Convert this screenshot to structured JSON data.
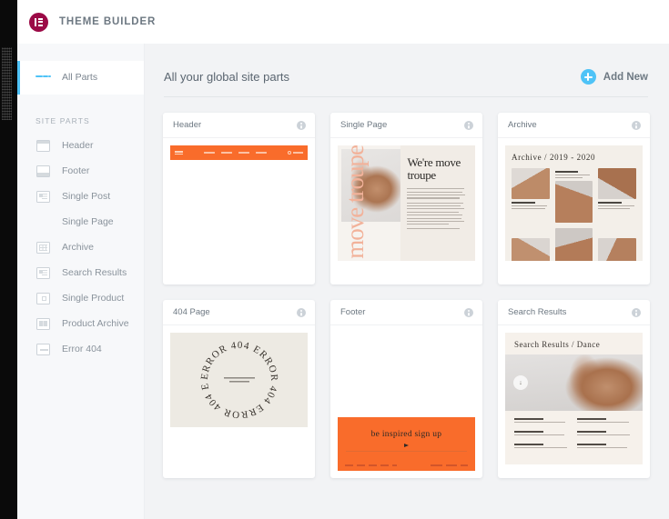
{
  "app": {
    "title": "THEME BUILDER",
    "logo_icon": "elementor-logo-icon",
    "brand_color": "#9b0a46",
    "accent_color": "#4fc3f7",
    "orange_color": "#f96c2b"
  },
  "sidebar": {
    "all_parts": {
      "label": "All Parts",
      "icon": "filter-lines-icon",
      "active": true
    },
    "section_label": "SITE PARTS",
    "items": [
      {
        "label": "Header",
        "icon": "header-layout-icon"
      },
      {
        "label": "Footer",
        "icon": "footer-layout-icon"
      },
      {
        "label": "Single Post",
        "icon": "single-post-icon"
      },
      {
        "label": "Single Page",
        "icon": "none"
      },
      {
        "label": "Archive",
        "icon": "archive-grid-icon"
      },
      {
        "label": "Search Results",
        "icon": "search-results-icon"
      },
      {
        "label": "Single Product",
        "icon": "single-product-icon"
      },
      {
        "label": "Product Archive",
        "icon": "product-archive-icon"
      },
      {
        "label": "Error 404",
        "icon": "error-404-icon"
      }
    ]
  },
  "main": {
    "title": "All your global site parts",
    "add_new": {
      "label": "Add New",
      "icon": "plus-circle-icon"
    },
    "cards": [
      {
        "name": "Header",
        "info_icon": "info-icon",
        "preview": "header"
      },
      {
        "name": "Single Page",
        "info_icon": "info-icon",
        "preview": "single-page"
      },
      {
        "name": "Archive",
        "info_icon": "info-icon",
        "preview": "archive"
      },
      {
        "name": "404 Page",
        "info_icon": "info-icon",
        "preview": "error-404"
      },
      {
        "name": "Footer",
        "info_icon": "info-icon",
        "preview": "footer"
      },
      {
        "name": "Search Results",
        "info_icon": "info-icon",
        "preview": "search-results"
      }
    ]
  },
  "previews": {
    "single_page": {
      "heading": "We're move troupe",
      "vertical_text": "move troupe"
    },
    "archive": {
      "title": "Archive / 2019 - 2020"
    },
    "error_404": {
      "ring_text": "ERROR 404 ERROR 404 ERROR 404 ERROR 404 "
    },
    "footer": {
      "headline": "be inspired sign up"
    },
    "search_results": {
      "title": "Search Results / Dance",
      "badge": "↓"
    }
  }
}
